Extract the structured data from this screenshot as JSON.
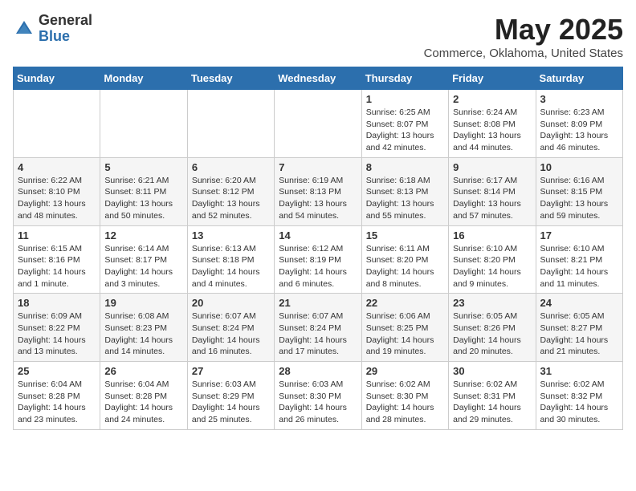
{
  "logo": {
    "general": "General",
    "blue": "Blue"
  },
  "title": "May 2025",
  "location": "Commerce, Oklahoma, United States",
  "days_of_week": [
    "Sunday",
    "Monday",
    "Tuesday",
    "Wednesday",
    "Thursday",
    "Friday",
    "Saturday"
  ],
  "weeks": [
    [
      {
        "day": "",
        "info": ""
      },
      {
        "day": "",
        "info": ""
      },
      {
        "day": "",
        "info": ""
      },
      {
        "day": "",
        "info": ""
      },
      {
        "day": "1",
        "info": "Sunrise: 6:25 AM\nSunset: 8:07 PM\nDaylight: 13 hours\nand 42 minutes."
      },
      {
        "day": "2",
        "info": "Sunrise: 6:24 AM\nSunset: 8:08 PM\nDaylight: 13 hours\nand 44 minutes."
      },
      {
        "day": "3",
        "info": "Sunrise: 6:23 AM\nSunset: 8:09 PM\nDaylight: 13 hours\nand 46 minutes."
      }
    ],
    [
      {
        "day": "4",
        "info": "Sunrise: 6:22 AM\nSunset: 8:10 PM\nDaylight: 13 hours\nand 48 minutes."
      },
      {
        "day": "5",
        "info": "Sunrise: 6:21 AM\nSunset: 8:11 PM\nDaylight: 13 hours\nand 50 minutes."
      },
      {
        "day": "6",
        "info": "Sunrise: 6:20 AM\nSunset: 8:12 PM\nDaylight: 13 hours\nand 52 minutes."
      },
      {
        "day": "7",
        "info": "Sunrise: 6:19 AM\nSunset: 8:13 PM\nDaylight: 13 hours\nand 54 minutes."
      },
      {
        "day": "8",
        "info": "Sunrise: 6:18 AM\nSunset: 8:13 PM\nDaylight: 13 hours\nand 55 minutes."
      },
      {
        "day": "9",
        "info": "Sunrise: 6:17 AM\nSunset: 8:14 PM\nDaylight: 13 hours\nand 57 minutes."
      },
      {
        "day": "10",
        "info": "Sunrise: 6:16 AM\nSunset: 8:15 PM\nDaylight: 13 hours\nand 59 minutes."
      }
    ],
    [
      {
        "day": "11",
        "info": "Sunrise: 6:15 AM\nSunset: 8:16 PM\nDaylight: 14 hours\nand 1 minute."
      },
      {
        "day": "12",
        "info": "Sunrise: 6:14 AM\nSunset: 8:17 PM\nDaylight: 14 hours\nand 3 minutes."
      },
      {
        "day": "13",
        "info": "Sunrise: 6:13 AM\nSunset: 8:18 PM\nDaylight: 14 hours\nand 4 minutes."
      },
      {
        "day": "14",
        "info": "Sunrise: 6:12 AM\nSunset: 8:19 PM\nDaylight: 14 hours\nand 6 minutes."
      },
      {
        "day": "15",
        "info": "Sunrise: 6:11 AM\nSunset: 8:20 PM\nDaylight: 14 hours\nand 8 minutes."
      },
      {
        "day": "16",
        "info": "Sunrise: 6:10 AM\nSunset: 8:20 PM\nDaylight: 14 hours\nand 9 minutes."
      },
      {
        "day": "17",
        "info": "Sunrise: 6:10 AM\nSunset: 8:21 PM\nDaylight: 14 hours\nand 11 minutes."
      }
    ],
    [
      {
        "day": "18",
        "info": "Sunrise: 6:09 AM\nSunset: 8:22 PM\nDaylight: 14 hours\nand 13 minutes."
      },
      {
        "day": "19",
        "info": "Sunrise: 6:08 AM\nSunset: 8:23 PM\nDaylight: 14 hours\nand 14 minutes."
      },
      {
        "day": "20",
        "info": "Sunrise: 6:07 AM\nSunset: 8:24 PM\nDaylight: 14 hours\nand 16 minutes."
      },
      {
        "day": "21",
        "info": "Sunrise: 6:07 AM\nSunset: 8:24 PM\nDaylight: 14 hours\nand 17 minutes."
      },
      {
        "day": "22",
        "info": "Sunrise: 6:06 AM\nSunset: 8:25 PM\nDaylight: 14 hours\nand 19 minutes."
      },
      {
        "day": "23",
        "info": "Sunrise: 6:05 AM\nSunset: 8:26 PM\nDaylight: 14 hours\nand 20 minutes."
      },
      {
        "day": "24",
        "info": "Sunrise: 6:05 AM\nSunset: 8:27 PM\nDaylight: 14 hours\nand 21 minutes."
      }
    ],
    [
      {
        "day": "25",
        "info": "Sunrise: 6:04 AM\nSunset: 8:28 PM\nDaylight: 14 hours\nand 23 minutes."
      },
      {
        "day": "26",
        "info": "Sunrise: 6:04 AM\nSunset: 8:28 PM\nDaylight: 14 hours\nand 24 minutes."
      },
      {
        "day": "27",
        "info": "Sunrise: 6:03 AM\nSunset: 8:29 PM\nDaylight: 14 hours\nand 25 minutes."
      },
      {
        "day": "28",
        "info": "Sunrise: 6:03 AM\nSunset: 8:30 PM\nDaylight: 14 hours\nand 26 minutes."
      },
      {
        "day": "29",
        "info": "Sunrise: 6:02 AM\nSunset: 8:30 PM\nDaylight: 14 hours\nand 28 minutes."
      },
      {
        "day": "30",
        "info": "Sunrise: 6:02 AM\nSunset: 8:31 PM\nDaylight: 14 hours\nand 29 minutes."
      },
      {
        "day": "31",
        "info": "Sunrise: 6:02 AM\nSunset: 8:32 PM\nDaylight: 14 hours\nand 30 minutes."
      }
    ]
  ]
}
